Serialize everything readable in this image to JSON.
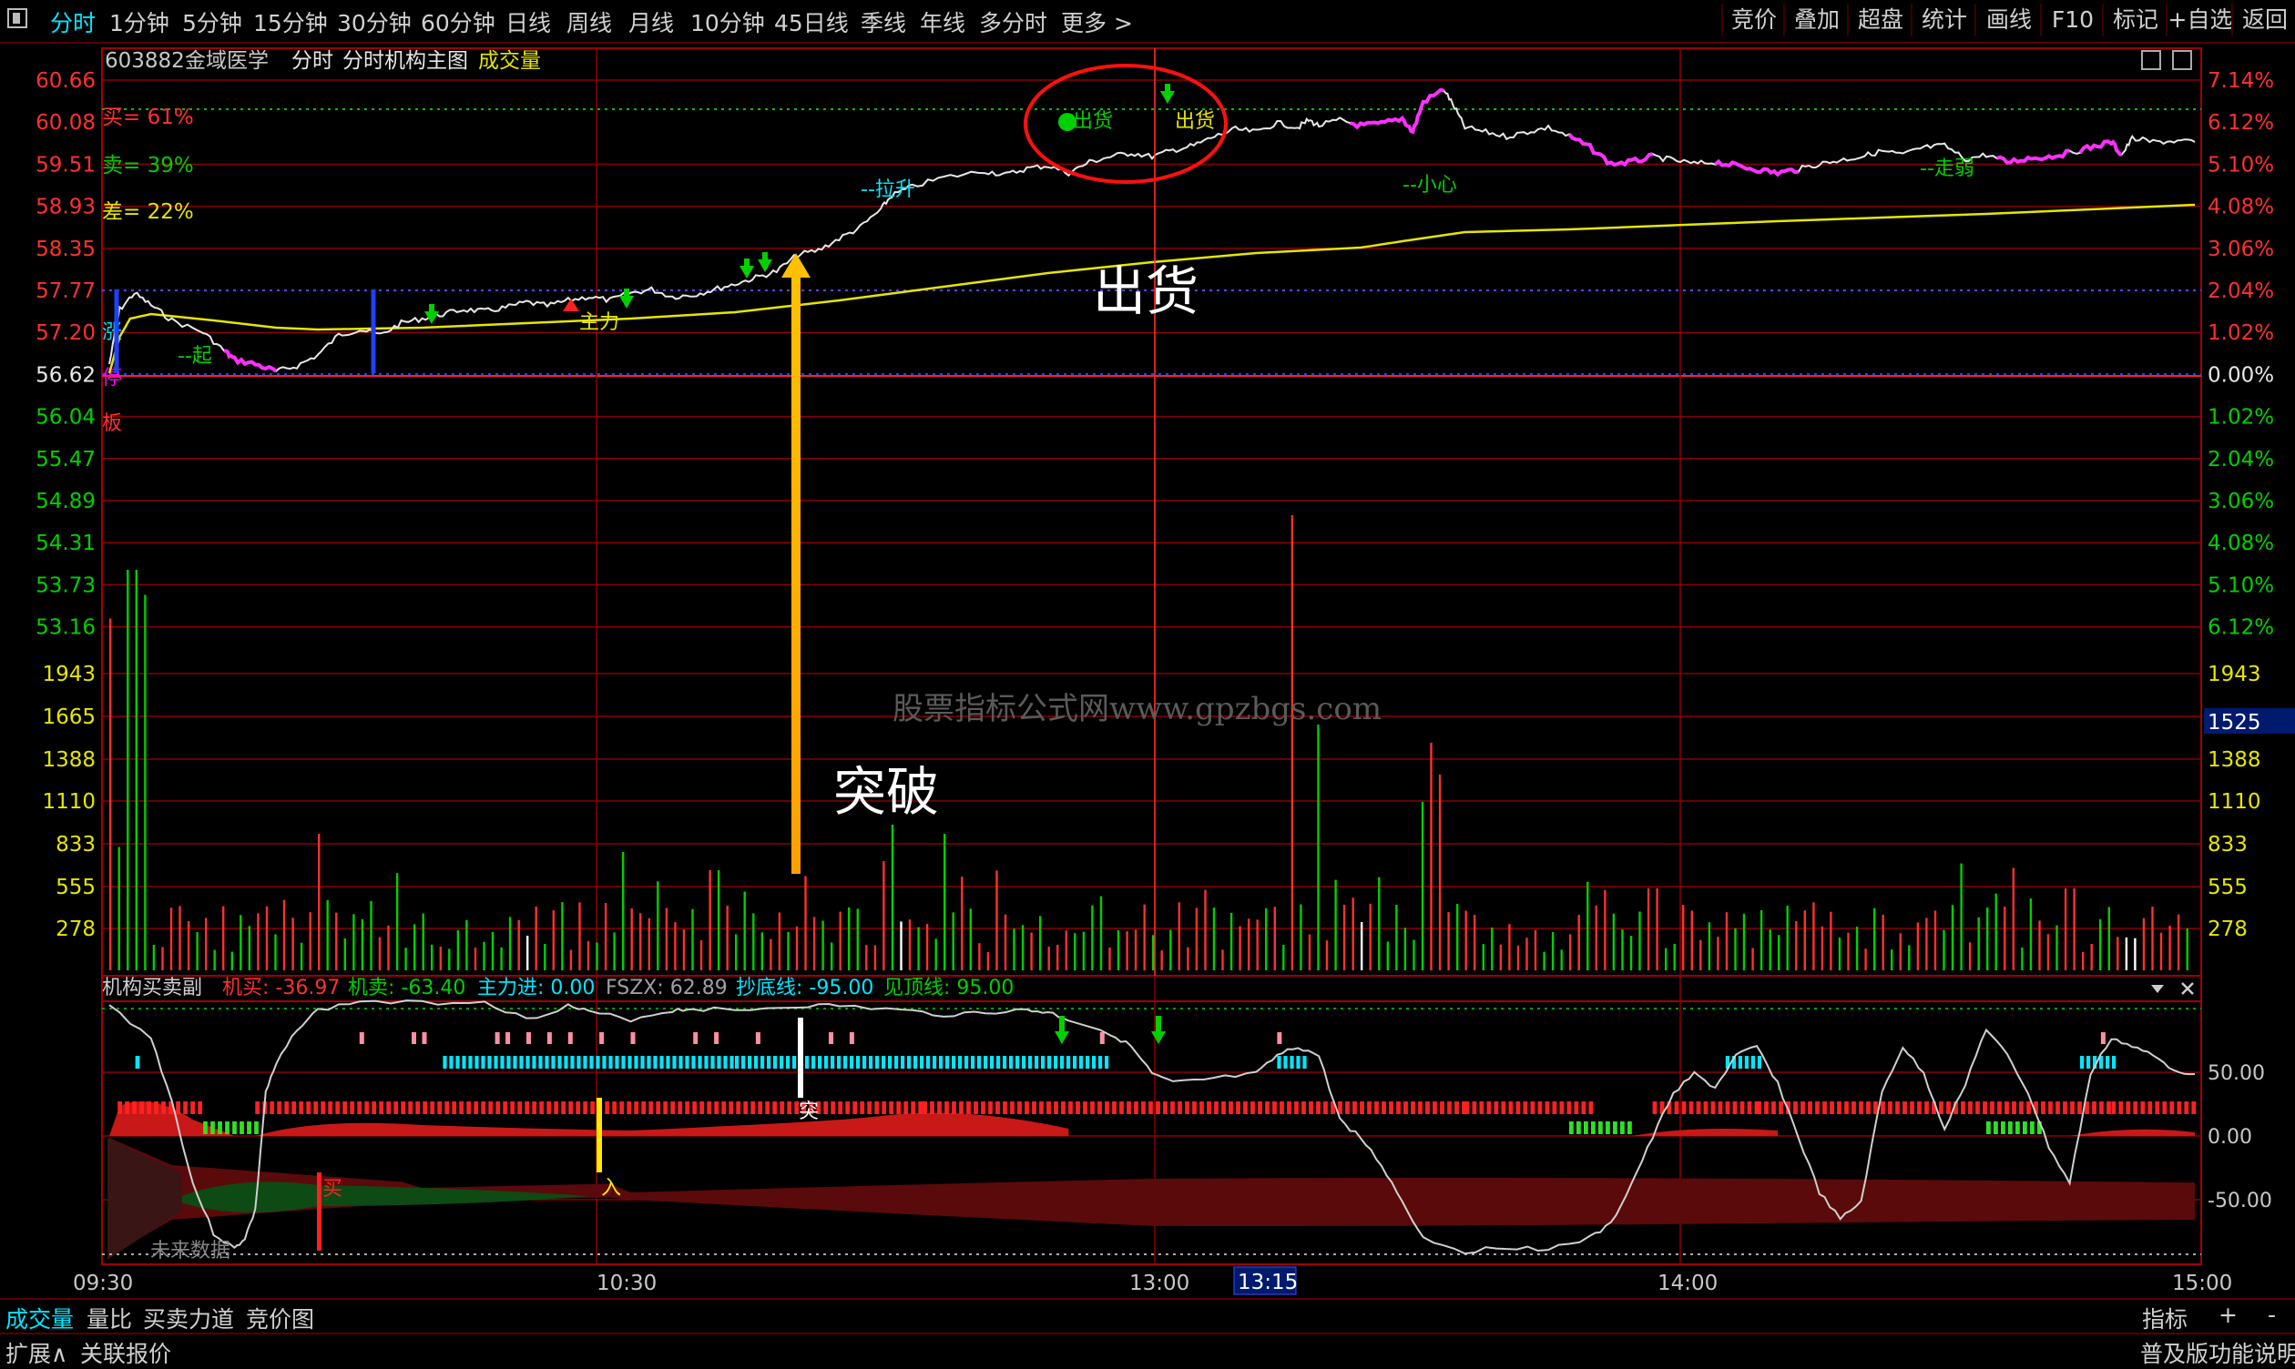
{
  "toolbar": {
    "tabs": [
      "分时",
      "1分钟",
      "5分钟",
      "15分钟",
      "30分钟",
      "60分钟",
      "日线",
      "周线",
      "月线",
      "10分钟",
      "45日线",
      "季线",
      "年线",
      "多分时",
      "更多 >"
    ],
    "active_tab": "分时",
    "right_buttons": [
      "竞价",
      "叠加",
      "超盘",
      "统计",
      "画线",
      "F10",
      "标记",
      "+自选",
      "返回"
    ]
  },
  "header": {
    "code": "603882",
    "name": "金域医学",
    "mode": "分时",
    "indicator": "分时机构主图",
    "volume_label": "成交量"
  },
  "price_axis": {
    "left": [
      "60.66",
      "60.08",
      "59.51",
      "58.93",
      "58.35",
      "57.77",
      "57.20",
      "56.62",
      "56.04",
      "55.47",
      "54.89",
      "54.31",
      "53.73",
      "53.16"
    ],
    "right": [
      "7.14%",
      "6.12%",
      "5.10%",
      "4.08%",
      "3.06%",
      "2.04%",
      "1.02%",
      "0.00%",
      "1.02%",
      "2.04%",
      "3.06%",
      "4.08%",
      "5.10%",
      "6.12%"
    ],
    "base_price": "56.62"
  },
  "stats": {
    "buy": "买= 61%",
    "sell": "卖= 39%",
    "diff": "差= 22%"
  },
  "limit_labels": [
    "涨",
    "停",
    "板"
  ],
  "annotations": {
    "start": "--起",
    "main_force": "主力",
    "rise": "--拉升",
    "sell_out_small": "出货",
    "sell_out_small2": "出货",
    "careful": "--小心",
    "weak": "--走弱",
    "sell_out_big": "出货",
    "breakout": "突破",
    "watermark": "股票指标公式网www.gpzbgs.com"
  },
  "volume_axis": {
    "left": [
      "1943",
      "1665",
      "1388",
      "1110",
      "833",
      "555",
      "278"
    ],
    "right": [
      "1943",
      "1388",
      "1110",
      "833",
      "555",
      "278"
    ],
    "current": "1525"
  },
  "sub_indicator": {
    "name": "机构买卖副",
    "jimai": "机买: -36.97",
    "jimai2": "机卖: -63.40",
    "zhuli": "主力进: 0.00",
    "fszx": "FSZX: 62.89",
    "chaodi": "抄底线: -95.00",
    "jianding": "见顶线: 95.00",
    "axis": [
      "50.00",
      "0.00",
      "-50.00"
    ],
    "labels": {
      "tu": "突",
      "ru": "入",
      "mai": "买",
      "future": "未来数据"
    }
  },
  "time_axis": {
    "labels": [
      "09:30",
      "10:30",
      "13:00",
      "14:00",
      "15:00"
    ],
    "cursor": "13:15"
  },
  "bottom": {
    "tabs": [
      "成交量",
      "量比",
      "买卖力道",
      "竞价图"
    ],
    "active_tab": "成交量",
    "right_tabs": [
      "指标",
      "+",
      "-"
    ],
    "row2_left": [
      "扩展∧",
      "关联报价"
    ],
    "row2_right": "普及版功能说明"
  },
  "colors": {
    "price_line": "#e8e8e8",
    "avg_line": "#e6e600",
    "up": "#ff3030",
    "down": "#00d000",
    "accent": "#00e6ff",
    "magenta": "#ff00ff",
    "grid": "#8b0000",
    "highlight": "#ffb000"
  },
  "icons": [
    "window-icon",
    "float-icon",
    "close-icon",
    "down-arrow-icon",
    "up-arrow-icon",
    "dropdown-icon"
  ]
}
